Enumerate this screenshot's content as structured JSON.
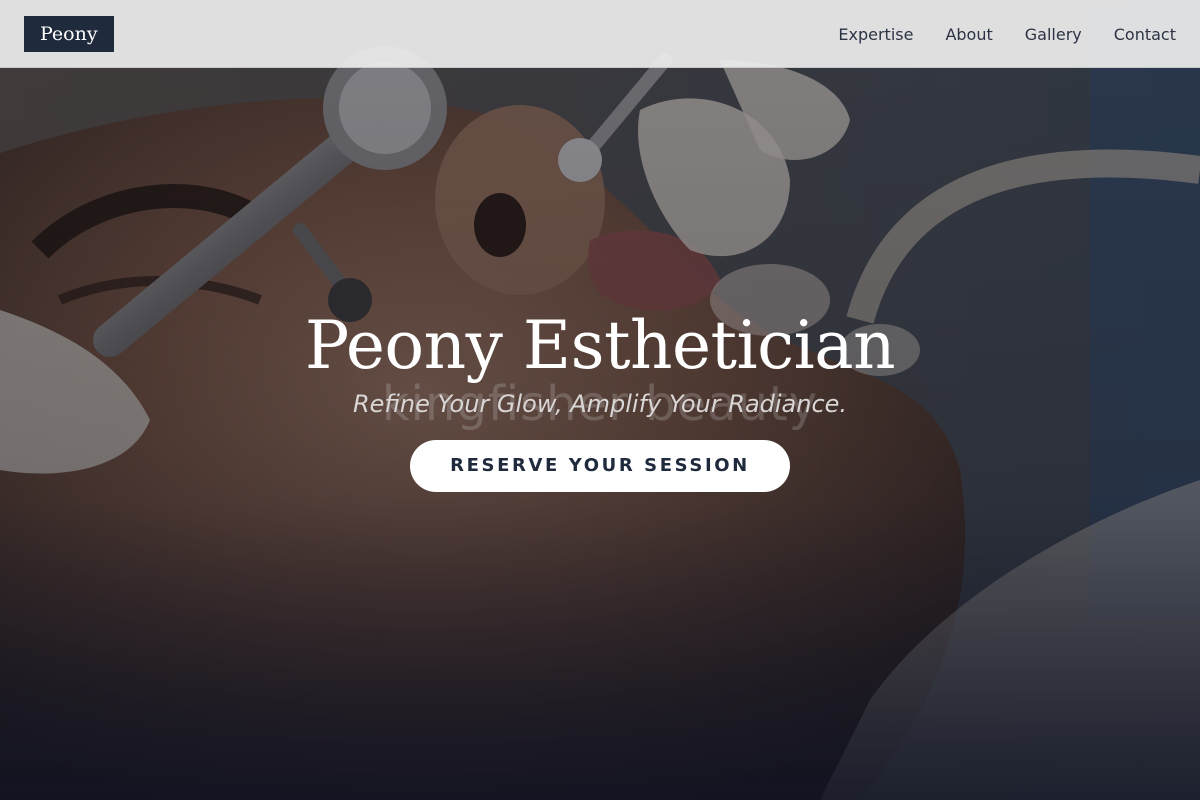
{
  "brand": {
    "logo_text": "Peony"
  },
  "nav": {
    "items": [
      {
        "label": "Expertise"
      },
      {
        "label": "About"
      },
      {
        "label": "Gallery"
      },
      {
        "label": "Contact"
      }
    ]
  },
  "hero": {
    "title": "Peony Esthetician",
    "subtitle": "Refine Your Glow, Amplify Your Radiance.",
    "watermark_text": "kingfisher beauty",
    "cta_label": "RESERVE YOUR SESSION",
    "background_image": "facial-treatment-photo"
  },
  "colors": {
    "header_bg": "#eeeeee",
    "logo_bg": "#1f2a3d",
    "nav_text": "#2b3344",
    "cta_bg": "#ffffff",
    "cta_text": "#1f2a3d",
    "title_text": "#ffffff"
  }
}
